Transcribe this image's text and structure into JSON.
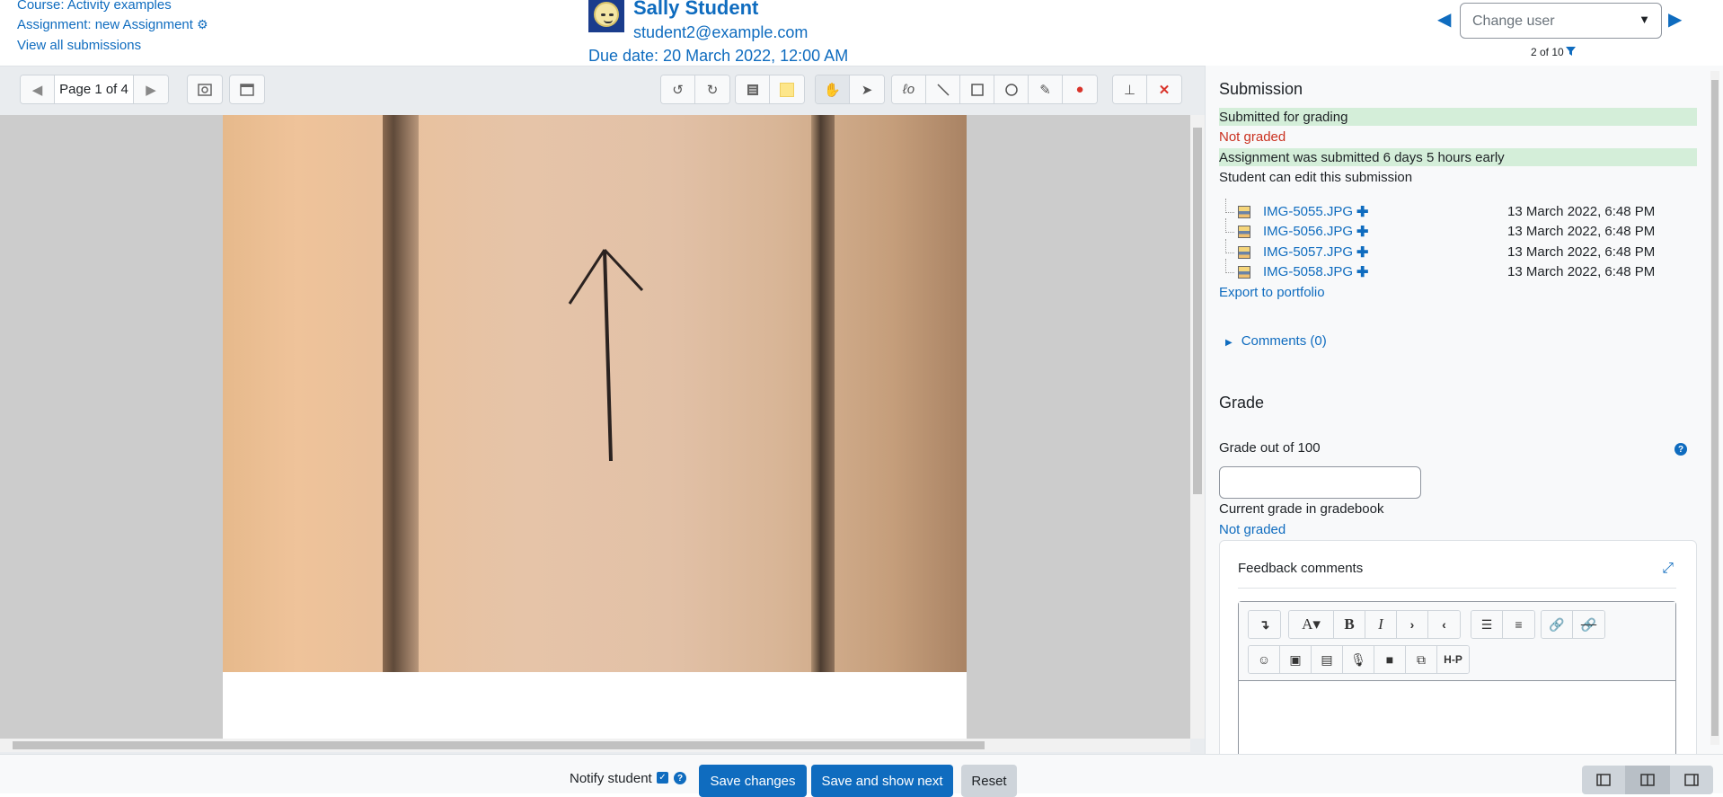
{
  "header": {
    "course_link": "Course: Activity examples",
    "assignment_link": "Assignment: new Assignment",
    "view_all": "View all submissions",
    "user_name": "Sally Student",
    "user_email": "student2@example.com",
    "due_date": "Due date: 20 March 2022, 12:00 AM",
    "change_user_placeholder": "Change user",
    "user_count": "2 of 10"
  },
  "toolbar": {
    "page_label": "Page 1 of 4"
  },
  "submission": {
    "heading": "Submission",
    "status_submitted": "Submitted for grading",
    "status_graded": "Not graded",
    "status_early": "Assignment was submitted 6 days 5 hours early",
    "status_edit": "Student can edit this submission",
    "files": [
      {
        "name": "IMG-5055.JPG",
        "date": "13 March 2022, 6:48 PM"
      },
      {
        "name": "IMG-5056.JPG",
        "date": "13 March 2022, 6:48 PM"
      },
      {
        "name": "IMG-5057.JPG",
        "date": "13 March 2022, 6:48 PM"
      },
      {
        "name": "IMG-5058.JPG",
        "date": "13 March 2022, 6:48 PM"
      }
    ],
    "export": "Export to portfolio",
    "comments": "Comments (0)"
  },
  "grade": {
    "heading": "Grade",
    "label": "Grade out of 100",
    "value": "",
    "gradebook_label": "Current grade in gradebook",
    "gradebook_value": "Not graded",
    "feedback_label": "Feedback comments",
    "h5p_label": "H-P"
  },
  "footer": {
    "notify": "Notify student",
    "save": "Save changes",
    "save_next": "Save and show next",
    "reset": "Reset"
  }
}
